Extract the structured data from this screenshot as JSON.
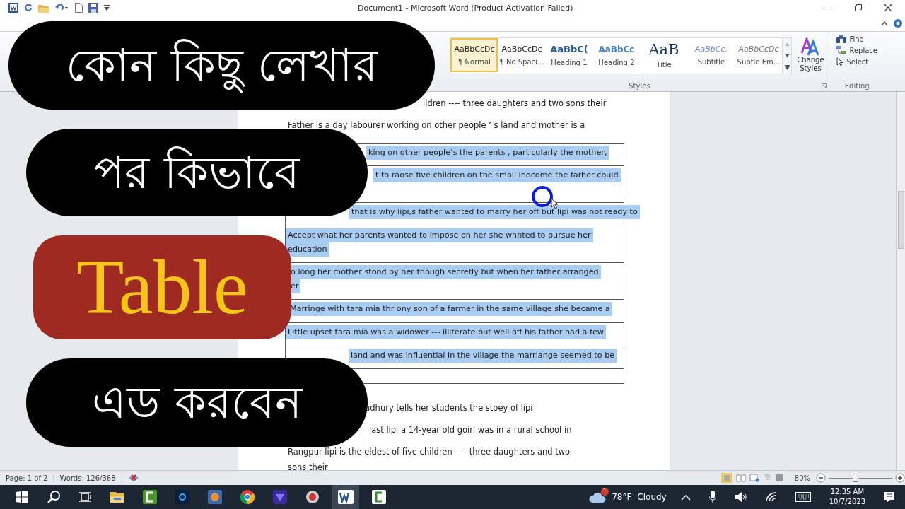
{
  "window": {
    "title": "Document1  -  Microsoft Word (Product Activation Failed)"
  },
  "styles_gallery": {
    "label": "Styles",
    "items": [
      {
        "sample": "AaBbCcDc",
        "name": "¶ Normal",
        "kind": "normal",
        "selected": true
      },
      {
        "sample": "AaBbCcDc",
        "name": "¶ No Spaci...",
        "kind": "normal",
        "selected": false
      },
      {
        "sample": "AaBbC(",
        "name": "Heading 1",
        "kind": "heading1",
        "selected": false
      },
      {
        "sample": "AaBbCc",
        "name": "Heading 2",
        "kind": "heading2",
        "selected": false
      },
      {
        "sample": "AaB",
        "name": "Title",
        "kind": "title",
        "selected": false
      },
      {
        "sample": "AaBbCc.",
        "name": "Subtitle",
        "kind": "subtitle",
        "selected": false
      },
      {
        "sample": "AaBbCcDc",
        "name": "Subtle Em...",
        "kind": "subtle",
        "selected": false
      }
    ]
  },
  "change_styles": "Change Styles",
  "editing": {
    "label": "Editing",
    "items": [
      "Find",
      "Replace",
      "Select"
    ]
  },
  "document": {
    "before": [
      {
        "lines": [
          "ildren ---- three daughters and two sons their"
        ]
      },
      {
        "lines": [
          "Father is a day labourer working on other people ‘ s land and mother is a"
        ]
      }
    ],
    "table_rows": [
      {
        "lines": [
          "king on other people’s the parents , particularly the mother,"
        ],
        "selected": true
      },
      {
        "lines": [
          "t to raose five children on the small inocome the farher could"
        ],
        "selected": true
      },
      {
        "lines": [
          "that is why lipi,s father wanted to marry her off but lipi was not ready to"
        ],
        "selected": true
      },
      {
        "lines": [
          "Accept what her parents wanted to impose on her she whnted to pursue her",
          "education"
        ],
        "selected": true
      },
      {
        "lines": [
          "o long her mother stood by her though secretly but when her father arranged",
          "er"
        ],
        "selected": true
      },
      {
        "lines": [
          "Marringe  with tara mia thr ony son of a farmer in the same village she became a"
        ],
        "selected": true
      },
      {
        "lines": [
          "Little upset  tara mia was a widower --- illiterate  but  well off his father had a few"
        ],
        "selected": true
      },
      {
        "lines": [
          "land and was influential in the village the marriange seemed to be"
        ],
        "selected": true
      },
      {
        "lines": [],
        "selected": false
      }
    ],
    "after": [
      {
        "lines": [
          "udhury tells her students  the stoey  of lipi"
        ]
      },
      {
        "lines": [
          "last lipi a 14-year old goirl was in a rural school in"
        ]
      },
      {
        "lines": [
          "Rangpur lipi is the eldest of five children ---- three daughters and two",
          "sons their"
        ]
      }
    ]
  },
  "status_bar": {
    "page": "Page: 1 of 2",
    "words": "Words: 126/368",
    "zoom": "80%",
    "level": 0.42
  },
  "overlay": [
    {
      "text": "কোন কিছু লেখার",
      "kind": "black"
    },
    {
      "text": "পর কিভাবে",
      "kind": "black"
    },
    {
      "text": "Table",
      "kind": "red"
    },
    {
      "text": "এড করবেন",
      "kind": "black"
    }
  ],
  "taskbar": {
    "weather": {
      "badge": "1",
      "temp": "78°F",
      "condition": "Cloudy"
    },
    "time": "12:35 AM",
    "date": "10/7/2023"
  }
}
